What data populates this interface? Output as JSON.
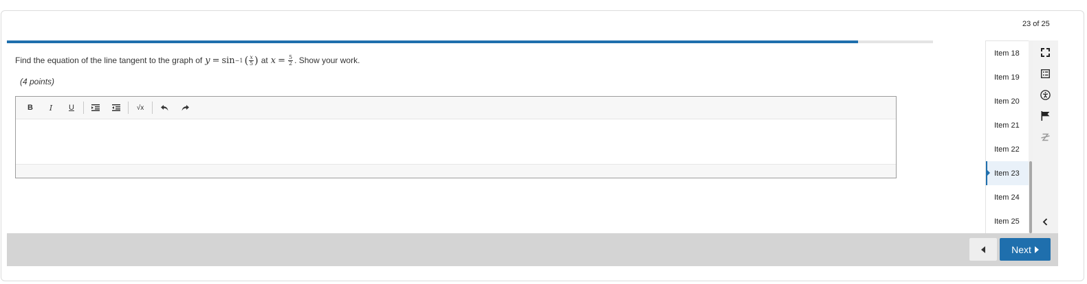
{
  "counter": "23 of 25",
  "progress": {
    "fraction": 0.919
  },
  "question": {
    "prefix": "Find the equation of the line tangent to the graph of",
    "y_var": "y",
    "equals": "=",
    "func": "sin",
    "exponent": "−1",
    "x_var": "x",
    "frac_a_num": "x",
    "frac_a_den": "5",
    "at_word": "at",
    "frac_b_num": "5",
    "frac_b_den": "2",
    "suffix": ". Show your work."
  },
  "points": "(4 points)",
  "toolbar": {
    "bold": "B",
    "italic": "I",
    "underline": "U",
    "sqrt": "√x"
  },
  "items": [
    {
      "label": "Item 18"
    },
    {
      "label": "Item 19"
    },
    {
      "label": "Item 20"
    },
    {
      "label": "Item 21"
    },
    {
      "label": "Item 22"
    },
    {
      "label": "Item 23",
      "active": true
    },
    {
      "label": "Item 24"
    },
    {
      "label": "Item 25"
    }
  ],
  "side_tools": [
    "fullscreen-icon",
    "reference-icon",
    "accessibility-icon",
    "flag-icon",
    "strikethrough-icon",
    "collapse-chevron-icon"
  ],
  "nav": {
    "next_label": "Next"
  },
  "colors": {
    "accent": "#1f6fad",
    "footer": "#d4d4d4"
  }
}
